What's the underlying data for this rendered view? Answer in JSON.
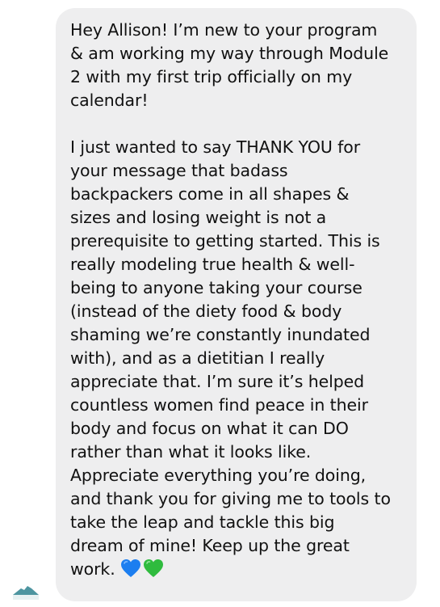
{
  "message": {
    "paragraph_1": "Hey Allison! I’m new to your program\n& am working my way through Module\n2 with my first trip officially on my\ncalendar!",
    "paragraph_2": "I just wanted to say THANK YOU for\nyour message that badass\nbackpackers come in all shapes &\nsizes and losing weight is not a\nprerequisite to getting started. This is\nreally modeling true health & well-\nbeing to anyone taking your course\n(instead of the diety food & body\nshaming we’re constantly inundated\nwith), and as a dietitian I really\nappreciate that. I’m sure it’s helped\ncountless women find peace in their\nbody and focus on what it can DO\nrather than what it looks like.\nAppreciate everything you’re doing,\nand thank you for giving me to tools to\ntake the leap and tackle this big\ndream of mine! Keep up the great\nwork.",
    "emojis": [
      "blue-heart-icon",
      "green-heart-icon"
    ]
  },
  "colors": {
    "bubble_background": "#eeeeef",
    "text": "#111111",
    "blue_heart": "#1c7ef0",
    "green_heart": "#2fbb3e",
    "avatar": "#3a8a96"
  }
}
